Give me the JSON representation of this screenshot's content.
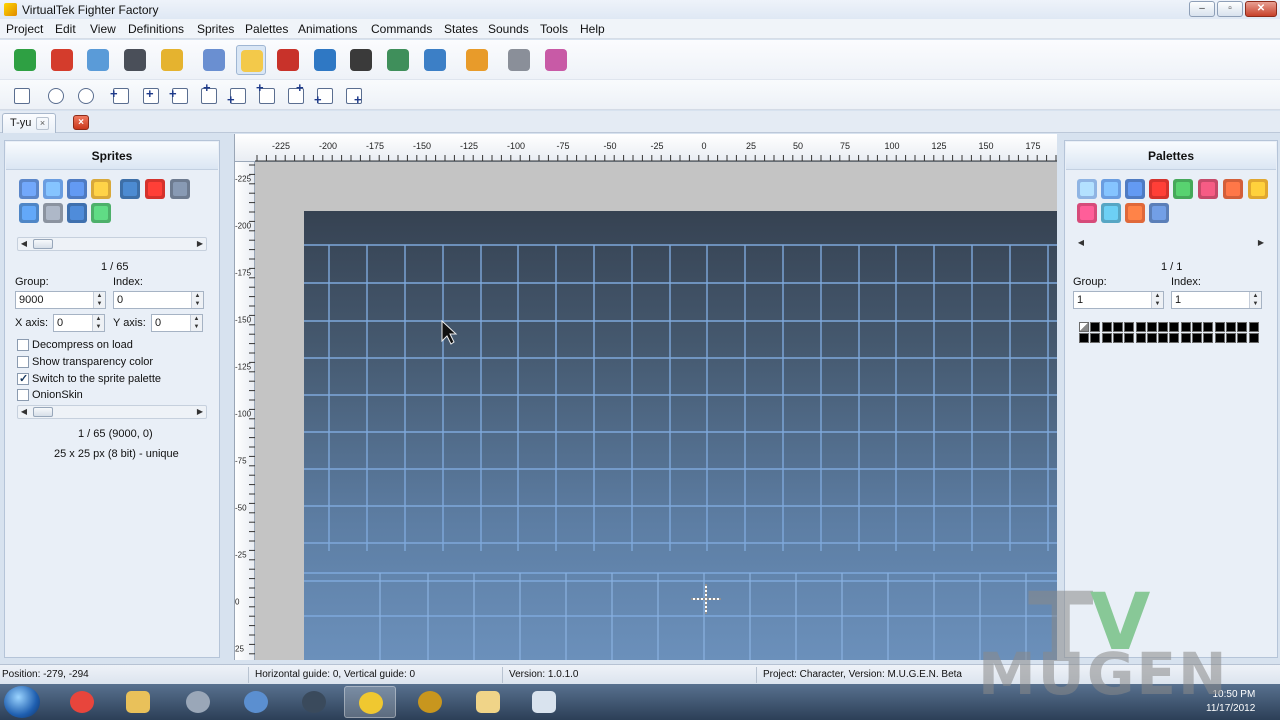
{
  "window": {
    "title": "VirtualTek Fighter Factory"
  },
  "menu": [
    "Project",
    "Edit",
    "View",
    "Definitions",
    "Sprites",
    "Palettes",
    "Animations",
    "Commands",
    "States",
    "Sounds",
    "Tools",
    "Help"
  ],
  "toolbar_main": [
    {
      "name": "new-project-icon",
      "color": "#2ea043"
    },
    {
      "name": "close-project-icon",
      "color": "#d43c2c"
    },
    {
      "name": "open-icon",
      "color": "#5a9bd8"
    },
    {
      "name": "save-icon",
      "color": "#4a4f59"
    },
    {
      "name": "lock-icon",
      "color": "#e5b32f"
    },
    {
      "name": "characters-icon",
      "color": "#6a8fd1"
    },
    {
      "name": "sprites-icon",
      "color": "#f3c94a",
      "active": true
    },
    {
      "name": "animations-clapper-icon",
      "color": "#c8322a"
    },
    {
      "name": "commands-window-icon",
      "color": "#2f78c4"
    },
    {
      "name": "joystick-icon",
      "color": "#3a3a3a"
    },
    {
      "name": "sounds-speaker-icon",
      "color": "#3f8f5b"
    },
    {
      "name": "export-image-icon",
      "color": "#3c7fc6"
    },
    {
      "name": "palette-icon",
      "color": "#e89b2a"
    },
    {
      "name": "tools-icon",
      "color": "#8a8f99"
    },
    {
      "name": "settings-icon",
      "color": "#c85aa6"
    }
  ],
  "toolbar_view": [
    {
      "name": "calculator-icon"
    },
    {
      "name": "zoom-in-icon"
    },
    {
      "name": "zoom-out-icon"
    },
    {
      "name": "add-left-icon"
    },
    {
      "name": "add-center-icon"
    },
    {
      "name": "add-right-icon"
    },
    {
      "name": "add-top-icon"
    },
    {
      "name": "add-bottom-left-icon"
    },
    {
      "name": "add-top-left-icon"
    },
    {
      "name": "add-top-right-icon"
    },
    {
      "name": "add-corner-left-icon"
    },
    {
      "name": "add-corner-right-icon"
    }
  ],
  "tabs": [
    {
      "label": "T-yu",
      "close": "×"
    }
  ],
  "tab_close_all": "×",
  "sprites_panel": {
    "title": "Sprites",
    "counter": "1 / 65",
    "group_label": "Group:",
    "group_value": "9000",
    "index_label": "Index:",
    "index_value": "0",
    "xaxis_label": "X axis:",
    "xaxis_value": "0",
    "yaxis_label": "Y axis:",
    "yaxis_value": "0",
    "options": [
      {
        "label": "Decompress on load",
        "checked": false
      },
      {
        "label": "Show transparency color",
        "checked": false
      },
      {
        "label": "Switch to the sprite palette",
        "checked": true
      },
      {
        "label": "OnionSkin",
        "checked": false
      }
    ],
    "info_line1": "1 / 65 (9000, 0)",
    "info_line2": "25 x 25 px (8 bit) - unique",
    "icons": [
      "new-sprite-icon",
      "open-sprite-icon",
      "save-sprite-icon",
      "sff-icon",
      "display-icon",
      "delete-icon",
      "export-icon",
      "search-icon",
      "tools-icon",
      "pcx-icon",
      "flip-icon"
    ]
  },
  "palettes_panel": {
    "title": "Palettes",
    "counter": "1 / 1",
    "group_label": "Group:",
    "group_value": "1",
    "index_label": "Index:",
    "index_value": "1",
    "icons": [
      "new-palette-icon",
      "open-palette-icon",
      "save-palette-icon",
      "delete-palette-icon",
      "refresh-icon",
      "grid-icon",
      "undo-icon",
      "redo-icon",
      "colors-icon",
      "eyedropper-icon",
      "swap-icon",
      "duplicate-icon"
    ]
  },
  "ruler_top": [
    "-225",
    "-200",
    "-175",
    "-150",
    "-125",
    "-100",
    "-75",
    "-50",
    "-25",
    "0",
    "25",
    "50",
    "75",
    "100",
    "125",
    "150",
    "175"
  ],
  "ruler_left": [
    "-225",
    "-200",
    "-175",
    "-150",
    "-125",
    "-100",
    "-75",
    "-50",
    "-25",
    "0",
    "25"
  ],
  "status": {
    "position": "Position: -279, -294",
    "guides": "Horizontal guide: 0, Vertical guide: 0",
    "version": "Version: 1.0.1.0",
    "project": "Project: Character, Version: M.U.G.E.N. Beta"
  },
  "taskbar": [
    {
      "name": "chrome-icon",
      "color": "#e8453c"
    },
    {
      "name": "explorer-folder-icon",
      "color": "#e9c15a"
    },
    {
      "name": "headset-icon",
      "color": "#9aa7b8"
    },
    {
      "name": "itunes-icon",
      "color": "#5b8fd0"
    },
    {
      "name": "steam-icon",
      "color": "#3a4a5c"
    },
    {
      "name": "fighter-factory-icon",
      "color": "#f0c830",
      "active": true
    },
    {
      "name": "warcraft-icon",
      "color": "#c8961e"
    },
    {
      "name": "folder-icon",
      "color": "#f0d488"
    },
    {
      "name": "window-icon",
      "color": "#d9e3ee"
    }
  ],
  "tray": {
    "time": "10:50 PM",
    "date": "11/17/2012"
  },
  "watermark": {
    "top": "T",
    "v": "V",
    "bottom": "MUGEN"
  }
}
